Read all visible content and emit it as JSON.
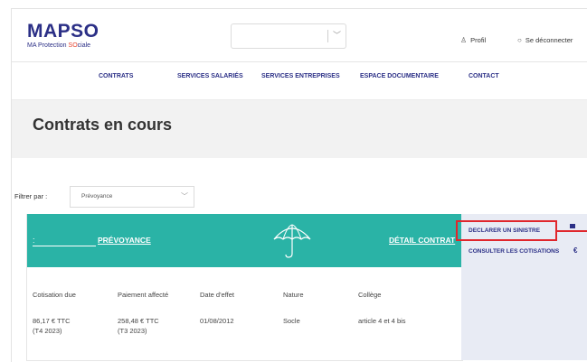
{
  "header": {
    "logo_main": "MAPSO",
    "logo_sub_prefix": "MA Protection ",
    "logo_sub_highlight": "SO",
    "logo_sub_suffix": "ciale",
    "profil_label": "Profil",
    "logout_label": "Se déconnecter"
  },
  "nav": {
    "items": [
      "CONTRATS",
      "SERVICES SALARIÉS",
      "SERVICES ENTREPRISES",
      "ESPACE DOCUMENTAIRE",
      "CONTACT"
    ]
  },
  "page": {
    "title": "Contrats en cours"
  },
  "filter": {
    "label": "Filtrer par :",
    "value": "Prévoyance"
  },
  "contract": {
    "colon": ":",
    "name": "PRÉVOYANCE",
    "detail_link": "DÉTAIL CONTRAT",
    "columns": [
      "Cotisation due",
      "Paiement affecté",
      "Date d'effet",
      "Nature",
      "Collège"
    ],
    "row": {
      "cotisation_line1": "86,17 € TTC",
      "cotisation_line2": "(T4 2023)",
      "paiement_line1": "258,48 € TTC",
      "paiement_line2": "(T3 2023)",
      "date_effet": "01/08/2012",
      "nature": "Socle",
      "college": "article 4 et 4 bis"
    }
  },
  "side_actions": [
    {
      "label": "DECLARER UN SINISTRE",
      "icon": "flag-icon"
    },
    {
      "label": "CONSULTER LES COTISATIONS",
      "icon": "euro-icon",
      "glyph": "€"
    }
  ],
  "colors": {
    "brand": "#2b2f86",
    "teal": "#2ab3a6",
    "accent_red": "#e8432e",
    "highlight": "#e0262c"
  }
}
